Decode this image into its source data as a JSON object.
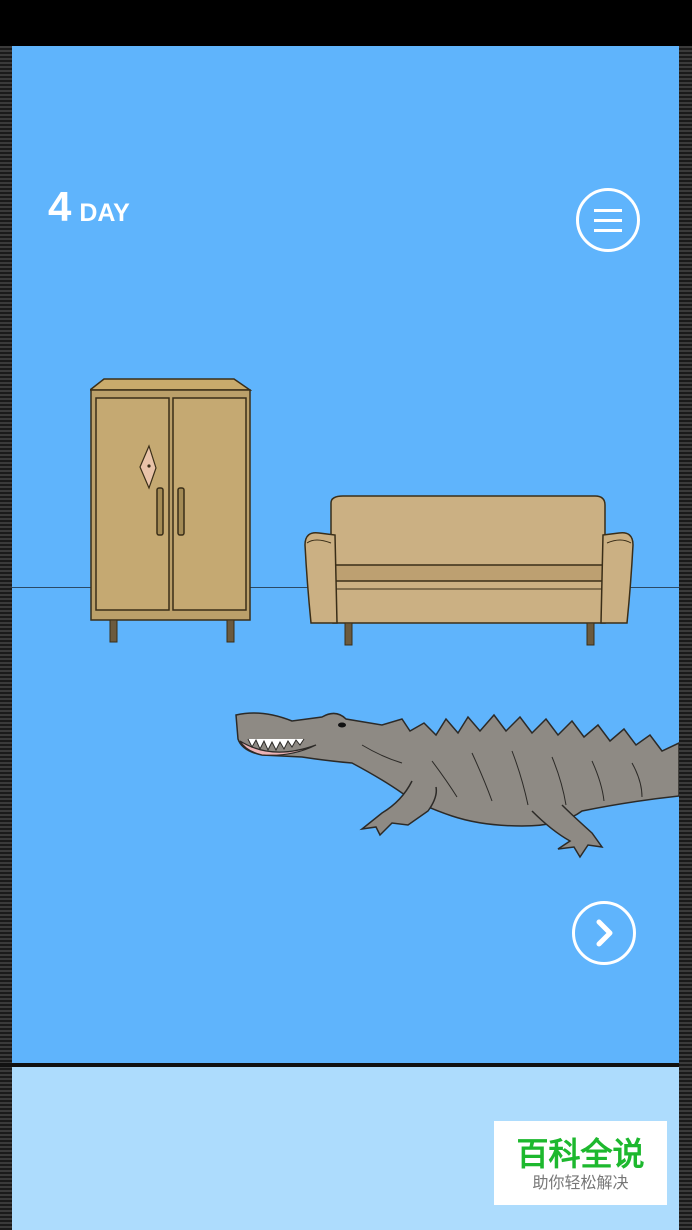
{
  "hud": {
    "day_number": "4",
    "day_label": "DAY"
  },
  "controls": {
    "menu_icon": "hamburger-menu-icon",
    "next_icon": "chevron-right-icon"
  },
  "scene": {
    "background_color": "#5fb4fc",
    "objects": [
      "wardrobe",
      "sofa",
      "crocodile",
      "small-picture-on-wardrobe"
    ]
  },
  "watermark": {
    "title": "百科全说",
    "subtitle": "助你轻松解决"
  }
}
